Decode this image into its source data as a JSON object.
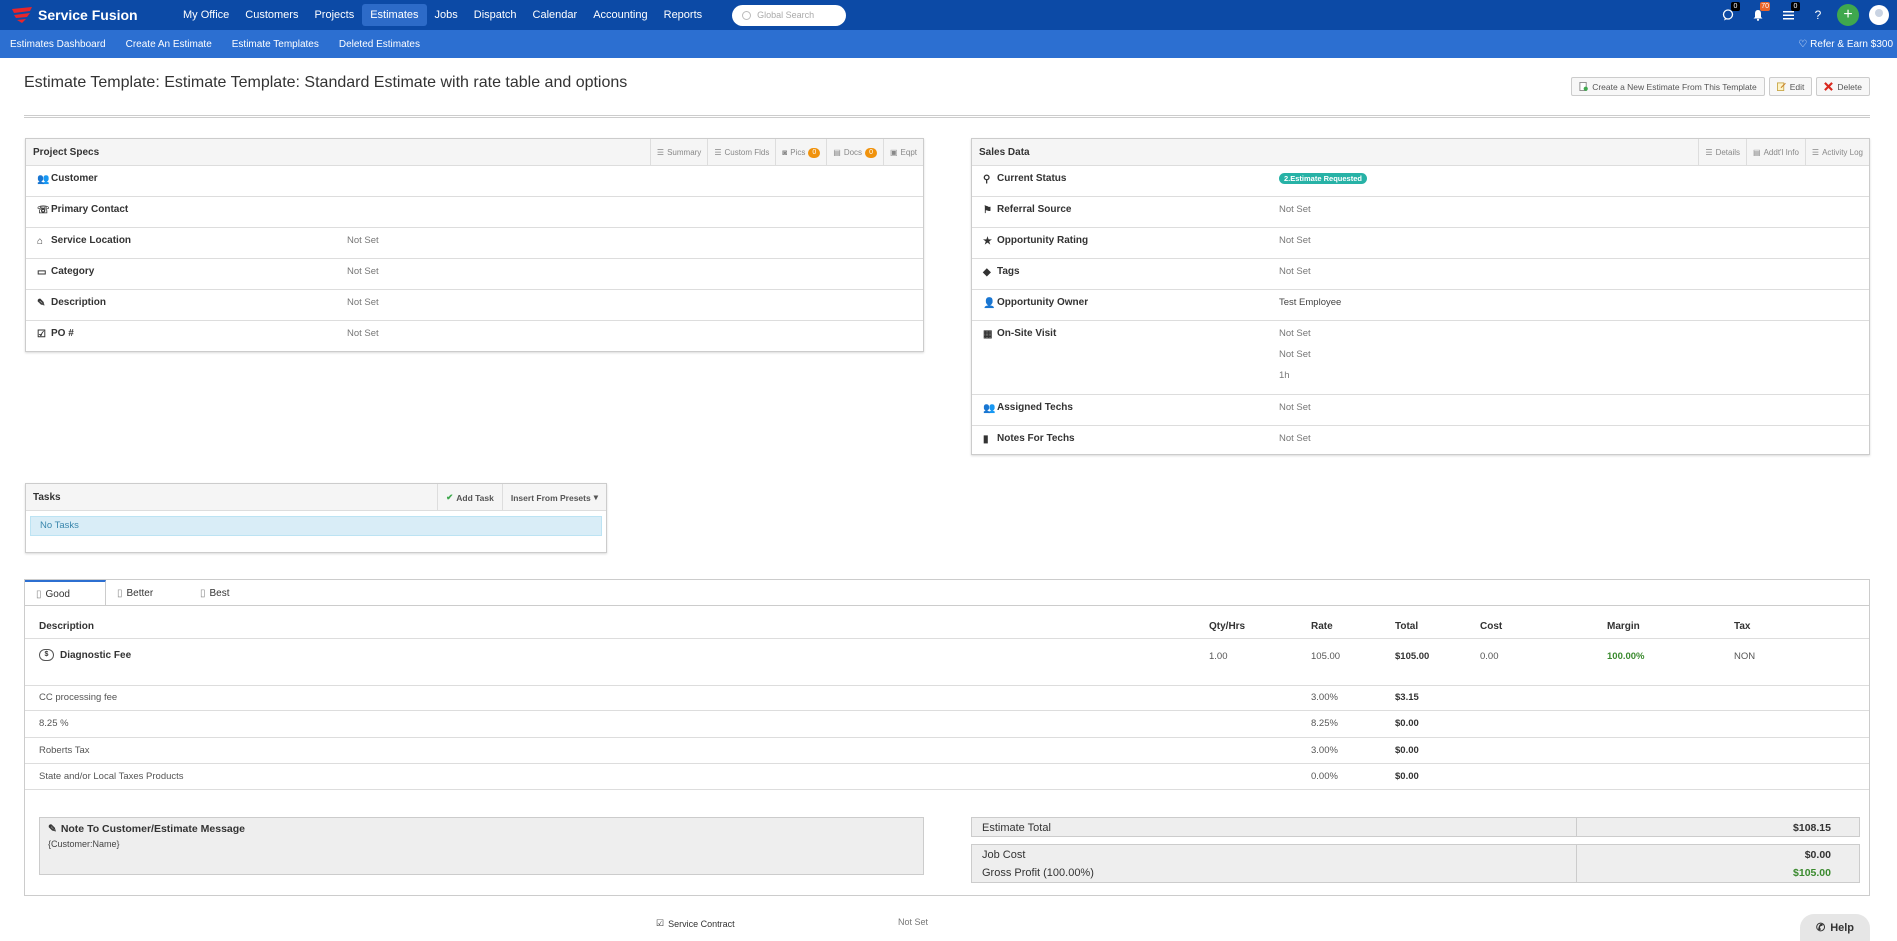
{
  "brand": {
    "name": "Service Fusion",
    "logo_color": "#e8262b"
  },
  "top_nav": [
    {
      "label": "My Office",
      "active": false
    },
    {
      "label": "Customers",
      "active": false
    },
    {
      "label": "Projects",
      "active": false
    },
    {
      "label": "Estimates",
      "active": true
    },
    {
      "label": "Jobs",
      "active": false
    },
    {
      "label": "Dispatch",
      "active": false
    },
    {
      "label": "Calendar",
      "active": false
    },
    {
      "label": "Accounting",
      "active": false
    },
    {
      "label": "Reports",
      "active": false
    }
  ],
  "search": {
    "placeholder": "Global Search"
  },
  "top_right": {
    "chat_count": "0",
    "notif_count": "70",
    "list_count": "0",
    "help": "?",
    "add": "+"
  },
  "sub_nav": [
    "Estimates Dashboard",
    "Create An Estimate",
    "Estimate Templates",
    "Deleted Estimates"
  ],
  "refer": "Refer & Earn $300",
  "page": {
    "title": "Estimate Template: Estimate Template: Standard Estimate with rate table and options",
    "buttons": {
      "create": "Create a New Estimate From This Template",
      "edit": "Edit",
      "delete": "Delete"
    }
  },
  "project_specs": {
    "title": "Project Specs",
    "tabs": {
      "summary": "Summary",
      "custom": "Custom Flds",
      "pics": "Pics",
      "pics_count": "0",
      "docs": "Docs",
      "docs_count": "0",
      "eqpt": "Eqpt"
    },
    "rows": [
      {
        "label": "Customer",
        "value": ""
      },
      {
        "label": "Primary Contact",
        "value": ""
      },
      {
        "label": "Service Location",
        "value": "Not Set"
      },
      {
        "label": "Category",
        "value": "Not Set"
      },
      {
        "label": "Description",
        "value": "Not Set"
      },
      {
        "label": "PO #",
        "value": "Not Set"
      }
    ]
  },
  "sales_data": {
    "title": "Sales Data",
    "tabs": {
      "details": "Details",
      "addl": "Addt'l Info",
      "activity": "Activity Log"
    },
    "current_status": {
      "label": "Current Status",
      "value": "2.Estimate Requested"
    },
    "referral": {
      "label": "Referral Source",
      "value": "Not Set"
    },
    "rating": {
      "label": "Opportunity Rating",
      "value": "Not Set"
    },
    "tags": {
      "label": "Tags",
      "value": "Not Set"
    },
    "owner": {
      "label": "Opportunity Owner",
      "value": "Test Employee"
    },
    "visit": {
      "label": "On-Site Visit",
      "v1": "Not Set",
      "v2": "Not Set",
      "v3": "1h"
    },
    "techs": {
      "label": "Assigned Techs",
      "value": "Not Set"
    },
    "notes": {
      "label": "Notes For Techs",
      "value": "Not Set"
    }
  },
  "tasks": {
    "title": "Tasks",
    "add": "Add Task",
    "insert": "Insert From Presets",
    "empty": "No Tasks"
  },
  "options_tabs": [
    "Good",
    "Better",
    "Best"
  ],
  "estimate_table": {
    "headers": {
      "description": "Description",
      "qty": "Qty/Hrs",
      "rate": "Rate",
      "total": "Total",
      "cost": "Cost",
      "margin": "Margin",
      "tax": "Tax"
    },
    "item": {
      "name": "Diagnostic Fee",
      "qty": "1.00",
      "rate": "105.00",
      "total": "$105.00",
      "cost": "0.00",
      "margin": "100.00%",
      "tax": "NON"
    },
    "fees": [
      {
        "name": "CC processing fee",
        "rate": "3.00%",
        "total": "$3.15"
      },
      {
        "name": "8.25 %",
        "rate": "8.25%",
        "total": "$0.00"
      },
      {
        "name": "Roberts Tax",
        "rate": "3.00%",
        "total": "$0.00"
      },
      {
        "name": "State and/or Local Taxes Products",
        "rate": "0.00%",
        "total": "$0.00"
      }
    ]
  },
  "note": {
    "title": "Note To Customer/Estimate Message",
    "body": "{Customer:Name}"
  },
  "totals": {
    "estimate_total_label": "Estimate Total",
    "estimate_total": "$108.15",
    "job_cost_label": "Job Cost",
    "job_cost": "$0.00",
    "gross_profit_label": "Gross Profit (100.00%)",
    "gross_profit": "$105.00"
  },
  "service_contract": {
    "label": "Service Contract",
    "value": "Not Set"
  },
  "help": "Help"
}
